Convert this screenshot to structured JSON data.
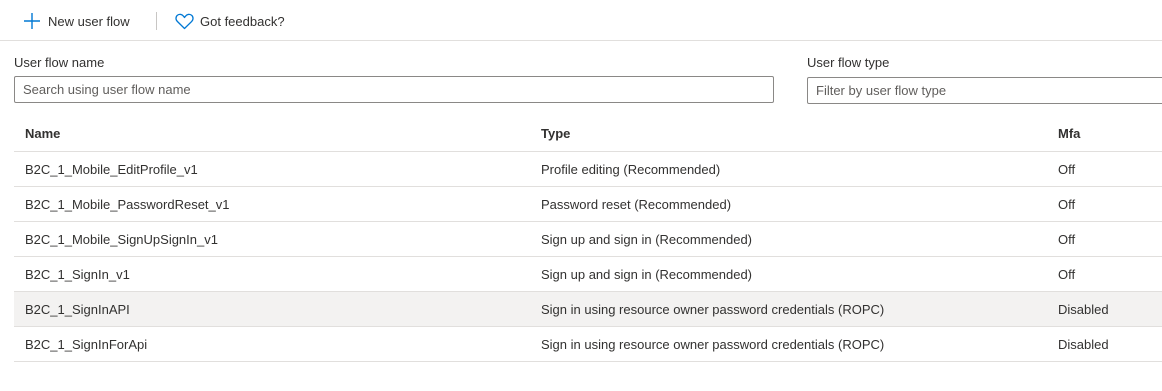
{
  "toolbar": {
    "new_label": "New user flow",
    "feedback_label": "Got feedback?",
    "new_icon": "plus-icon",
    "feedback_icon": "heart-icon",
    "accent": "#0078d4"
  },
  "filters": {
    "name_label": "User flow name",
    "name_placeholder": "Search using user flow name",
    "type_label": "User flow type",
    "type_placeholder": "Filter by user flow type"
  },
  "table": {
    "columns": [
      "Name",
      "Type",
      "Mfa"
    ],
    "rows": [
      {
        "name": "B2C_1_Mobile_EditProfile_v1",
        "type": "Profile editing (Recommended)",
        "mfa": "Off"
      },
      {
        "name": "B2C_1_Mobile_PasswordReset_v1",
        "type": "Password reset (Recommended)",
        "mfa": "Off"
      },
      {
        "name": "B2C_1_Mobile_SignUpSignIn_v1",
        "type": "Sign up and sign in (Recommended)",
        "mfa": "Off"
      },
      {
        "name": "B2C_1_SignIn_v1",
        "type": "Sign up and sign in (Recommended)",
        "mfa": "Off"
      },
      {
        "name": "B2C_1_SignInAPI",
        "type": "Sign in using resource owner password credentials (ROPC)",
        "mfa": "Disabled"
      },
      {
        "name": "B2C_1_SignInForApi",
        "type": "Sign in using resource owner password credentials (ROPC)",
        "mfa": "Disabled"
      }
    ],
    "selected_row_index": 4
  }
}
